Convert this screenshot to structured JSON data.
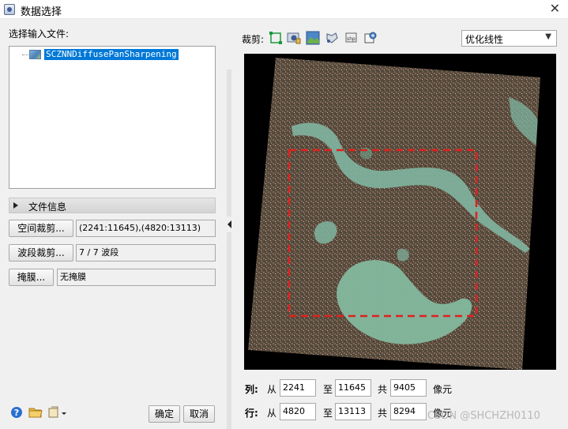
{
  "window": {
    "title": "数据选择",
    "close_glyph": "✕"
  },
  "left": {
    "input_label": "选择输入文件:",
    "tree_item": "SCZNNDiffusePanSharpening",
    "file_info_label": "文件信息",
    "spatial_crop_button": "空间裁剪...",
    "spatial_crop_value": "(2241:11645),(4820:13113)",
    "band_crop_button": "波段裁剪...",
    "band_crop_value": "7 / 7 波段",
    "mask_button": "掩膜...",
    "mask_value": "无掩膜",
    "ok_button": "确定",
    "cancel_button": "取消"
  },
  "toolbar": {
    "crop_label": "裁剪:",
    "icons": [
      "crop-rect-icon",
      "crop-image-icon",
      "crop-vector-icon",
      "crop-roi-icon",
      "crop-file-icon",
      "crop-map-icon"
    ],
    "stretch_select": "优化线性"
  },
  "columns": {
    "label": "列:",
    "from_label": "从",
    "from": "2241",
    "to_label": "至",
    "to": "11645",
    "total_label": "共",
    "total": "9405",
    "unit": "像元"
  },
  "rows": {
    "label": "行:",
    "from_label": "从",
    "from": "4820",
    "to_label": "至",
    "to": "13113",
    "total_label": "共",
    "total": "8294",
    "unit": "像元"
  },
  "watermark": "CSDN @SHCHZH0110",
  "colors": {
    "selection": "#0078d7",
    "crop_box": "#e02020",
    "background": "#f0f0f0"
  }
}
